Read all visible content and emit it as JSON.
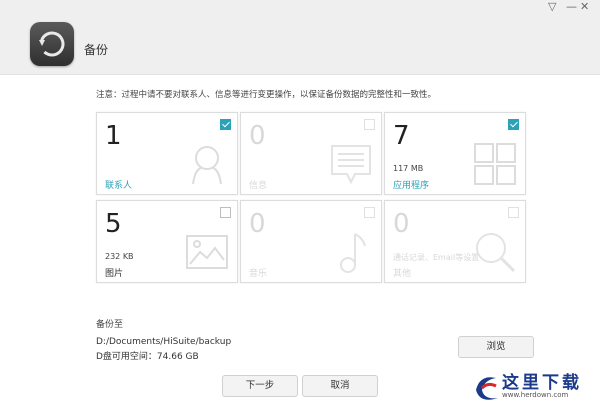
{
  "header": {
    "title": "备份"
  },
  "notice": "注意：过程中请不要对联系人、信息等进行变更操作，以保证备份数据的完整性和一致性。",
  "tiles": [
    {
      "count": "1",
      "size": "",
      "label": "联系人",
      "checked": true,
      "enabled": true,
      "icon": "contact-icon"
    },
    {
      "count": "0",
      "size": "",
      "label": "信息",
      "checked": false,
      "enabled": false,
      "icon": "message-icon"
    },
    {
      "count": "7",
      "size": "117 MB",
      "label": "应用程序",
      "checked": true,
      "enabled": true,
      "icon": "apps-grid-icon"
    },
    {
      "count": "5",
      "size": "232 KB",
      "label": "图片",
      "checked": false,
      "enabled": true,
      "icon": "picture-icon"
    },
    {
      "count": "0",
      "size": "",
      "label": "音乐",
      "checked": false,
      "enabled": false,
      "icon": "music-note-icon"
    },
    {
      "count": "0",
      "size": "通话记录、Email等设置",
      "label": "其他",
      "checked": false,
      "enabled": false,
      "icon": "magnifier-icon"
    }
  ],
  "backup": {
    "to_label": "备份至",
    "path": "D:/Documents/HiSuite/backup",
    "free_space": "D盘可用空间：74.66 GB",
    "browse_label": "浏览"
  },
  "buttons": {
    "next": "下一步",
    "cancel": "取消"
  },
  "watermark": {
    "site_cn": "这里下载",
    "site_url": "www.herdown.com"
  },
  "colors": {
    "accent": "#2aa3b8",
    "header_bg": "#efefef",
    "watermark_blue": "#1b3a8a"
  }
}
